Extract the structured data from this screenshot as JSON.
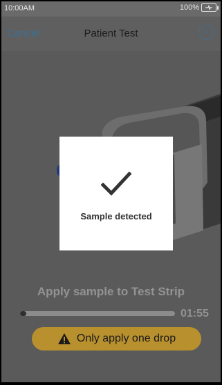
{
  "status_bar": {
    "time": "10:00AM",
    "battery": "100%"
  },
  "nav": {
    "cancel": "Cancel",
    "title": "Patient Test",
    "info_icon": "info-icon"
  },
  "dialog": {
    "icon": "checkmark-icon",
    "message": "Sample detected"
  },
  "instruction": "Apply sample to Test Strip",
  "progress": {
    "fraction": 0.04,
    "timer": "01:55"
  },
  "warning": {
    "icon": "warning-triangle-icon",
    "text": "Only apply one drop"
  },
  "colors": {
    "accent": "#3c6f94",
    "warning": "#b8902e",
    "overlay": "#5a5a5a"
  }
}
